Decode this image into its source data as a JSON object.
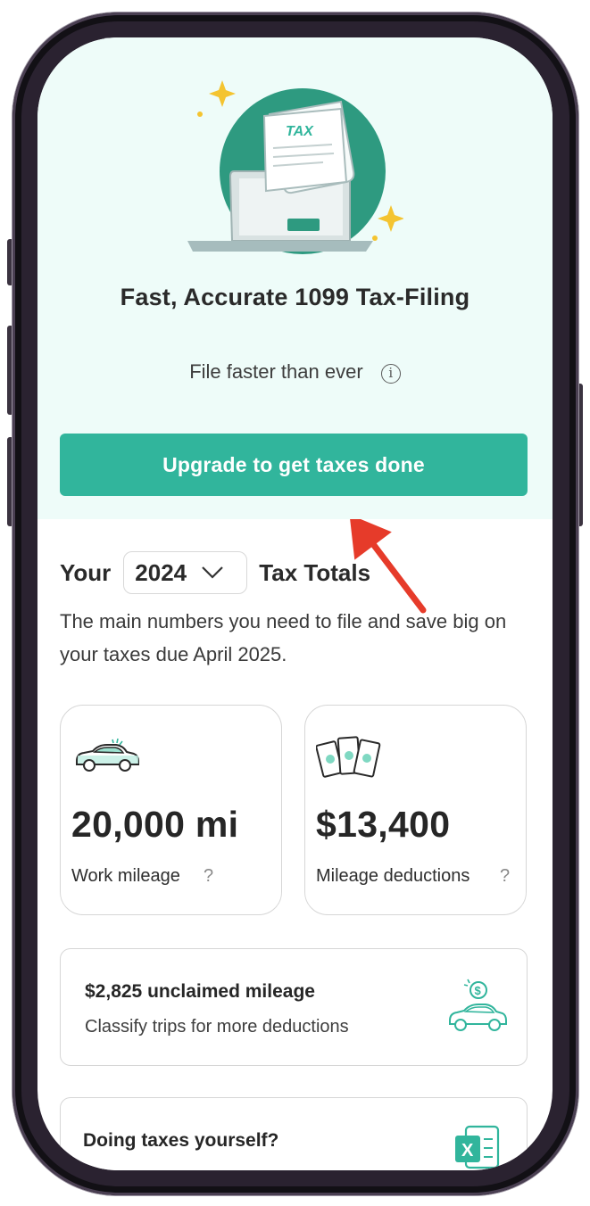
{
  "hero": {
    "illustration_label": "TAX",
    "title": "Fast, Accurate 1099 Tax-Filing",
    "subtitle": "File faster than ever",
    "info_glyph": "i",
    "upgrade_button": "Upgrade to get taxes done"
  },
  "totals": {
    "prefix": "Your",
    "year": "2024",
    "suffix": "Tax Totals",
    "description": "The main numbers you need to file and save big on your taxes due April 2025."
  },
  "cards": {
    "mileage": {
      "value": "20,000 mi",
      "label": "Work mileage",
      "help": "?",
      "icon": "car-icon"
    },
    "deductions": {
      "value": "$13,400",
      "label": "Mileage deductions",
      "help": "?",
      "icon": "money-bills-icon"
    }
  },
  "unclaimed": {
    "title": "$2,825 unclaimed mileage",
    "subtitle": "Classify trips for more deductions",
    "icon": "car-coin-icon"
  },
  "diy": {
    "title": "Doing taxes yourself?",
    "icon": "excel-icon"
  },
  "colors": {
    "accent": "#31b59c",
    "dark_teal": "#2e9a80",
    "hero_bg": "#eefcf9",
    "annotation_arrow": "#e63b2a"
  }
}
